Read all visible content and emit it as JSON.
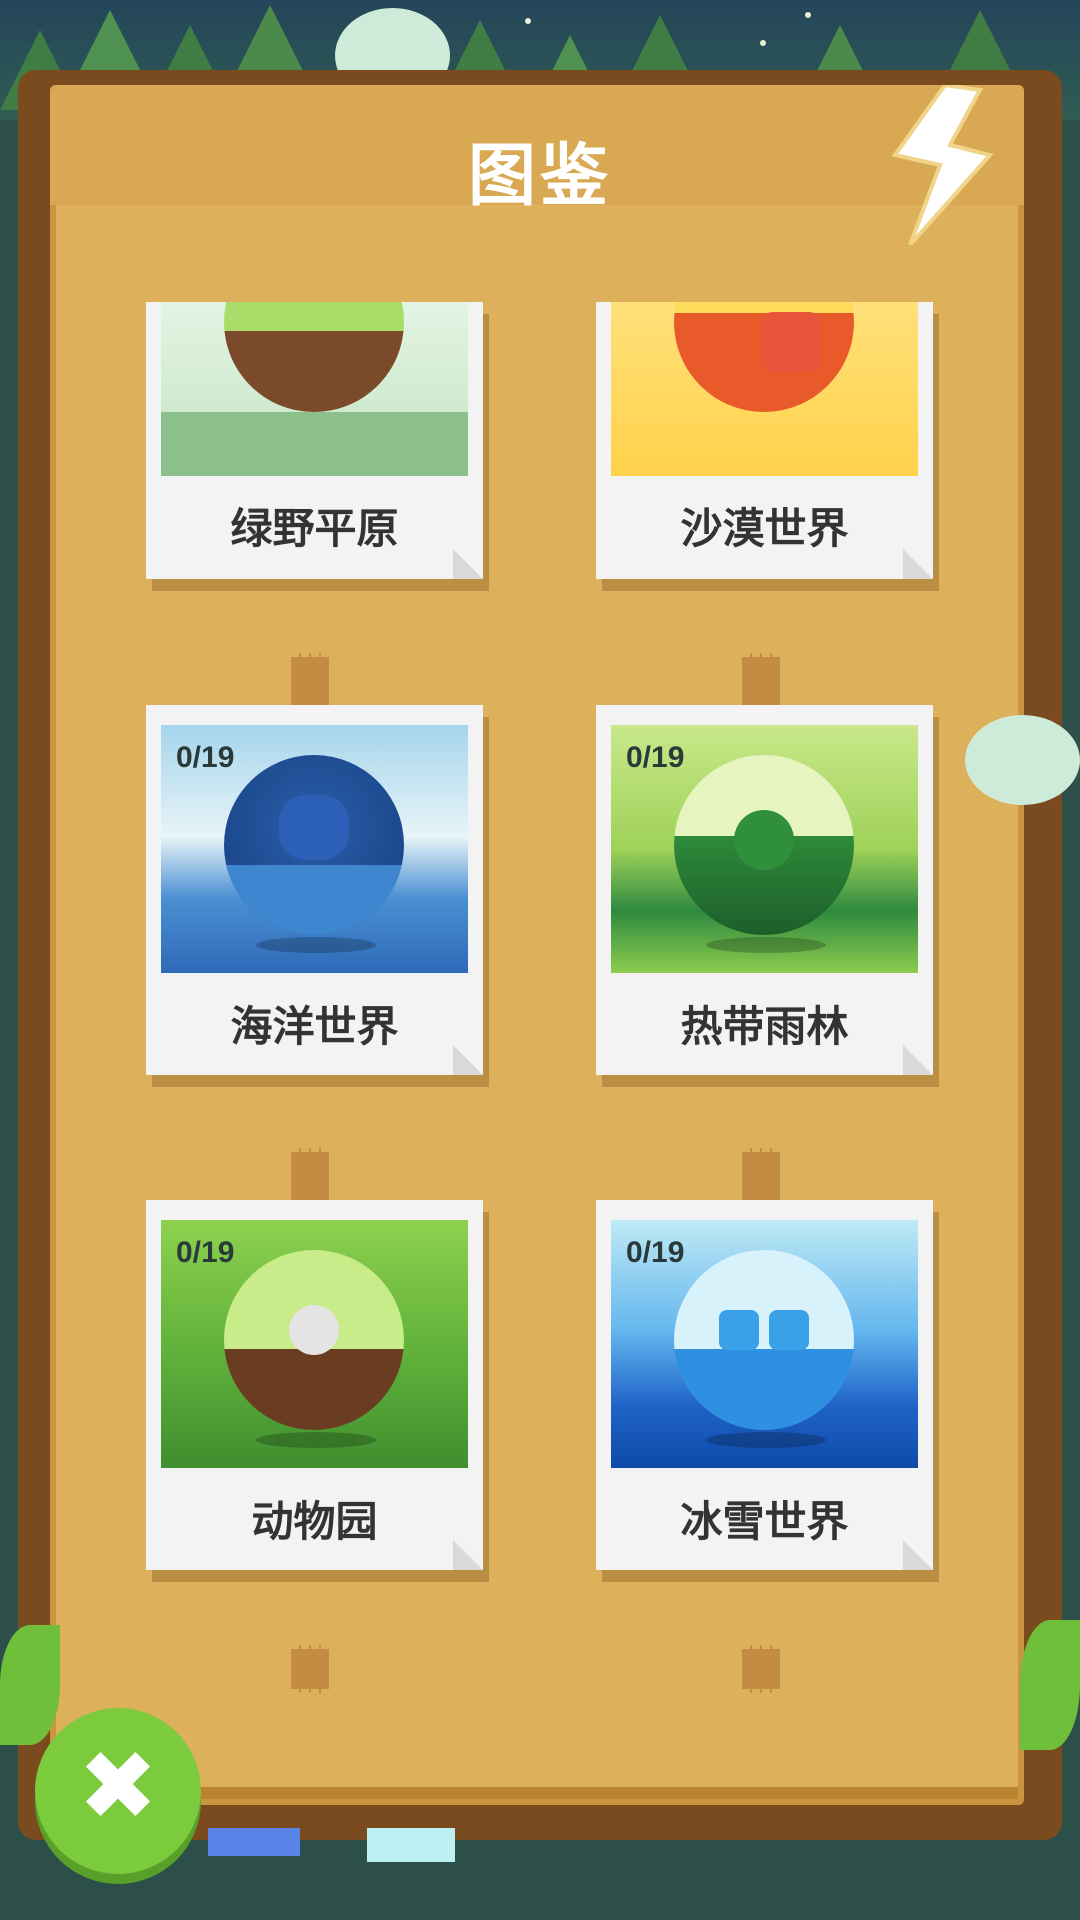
{
  "header": {
    "title": "图鉴"
  },
  "cards": [
    {
      "name": "绿野平原",
      "count": "",
      "theme": "grassland"
    },
    {
      "name": "沙漠世界",
      "count": "",
      "theme": "desert"
    },
    {
      "name": "海洋世界",
      "count": "0/19",
      "theme": "ocean"
    },
    {
      "name": "热带雨林",
      "count": "0/19",
      "theme": "rainforest"
    },
    {
      "name": "动物园",
      "count": "0/19",
      "theme": "zoo"
    },
    {
      "name": "冰雪世界",
      "count": "0/19",
      "theme": "snow"
    }
  ],
  "colors": {
    "board": "#ddb05c",
    "frame": "#7a4b1e",
    "close_button": "#7ccb3c",
    "card": "#f3f3f3"
  },
  "icons": {
    "close": "close-icon",
    "lightning": "lightning-icon"
  }
}
